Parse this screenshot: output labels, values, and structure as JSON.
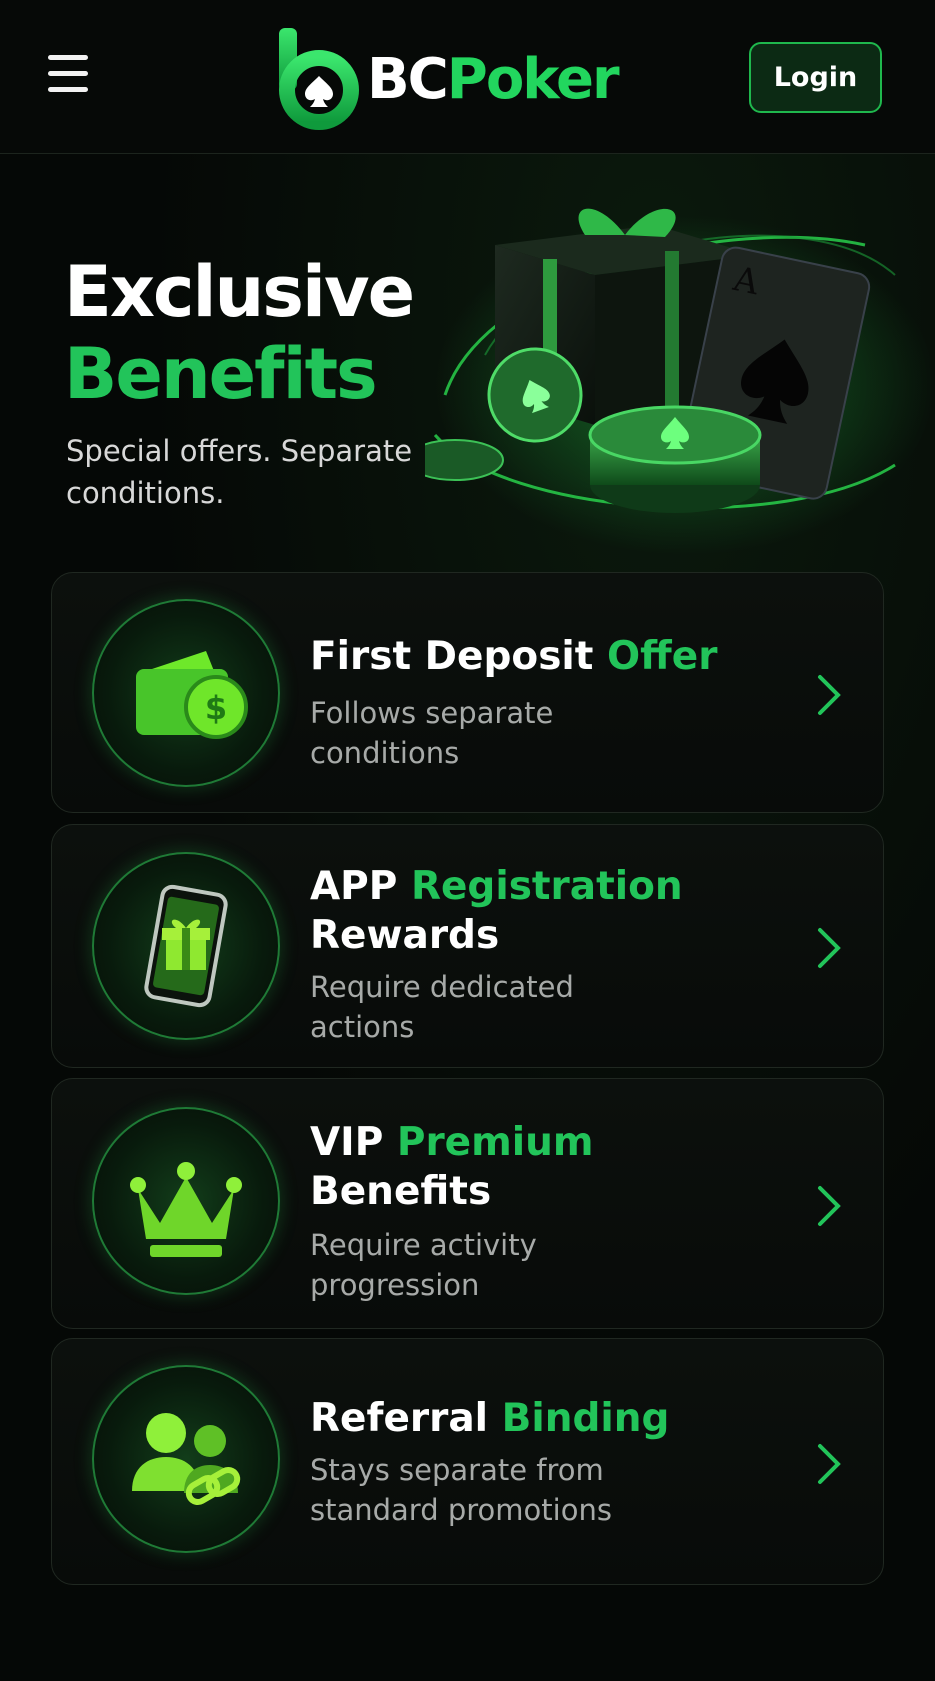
{
  "header": {
    "logo_bc": "BC",
    "logo_poker": "Poker",
    "login_label": "Login",
    "menu_icon": "hamburger-menu-icon"
  },
  "hero": {
    "title_line1": "Exclusive",
    "title_line2": "Benefits",
    "subtitle": "Special offers. Separate conditions."
  },
  "cards": [
    {
      "title_white": "First Deposit",
      "title_green": "Offer",
      "title_line2": "",
      "description": "Follows separate conditions",
      "icon": "wallet-dollar-icon"
    },
    {
      "title_white": "APP",
      "title_green": "Registration",
      "title_line2": "Rewards",
      "description": "Require dedicated actions",
      "icon": "phone-gift-icon"
    },
    {
      "title_white": "VIP",
      "title_green": "Premium",
      "title_line2": "Benefits",
      "description": "Require activity progression",
      "icon": "crown-icon"
    },
    {
      "title_white": "Referral",
      "title_green": "Binding",
      "title_line2": "",
      "description": "Stays separate from standard promotions",
      "icon": "users-link-icon"
    }
  ],
  "colors": {
    "accent": "#22c45a",
    "background": "#050806",
    "card_bg": "#0a0e0b"
  }
}
